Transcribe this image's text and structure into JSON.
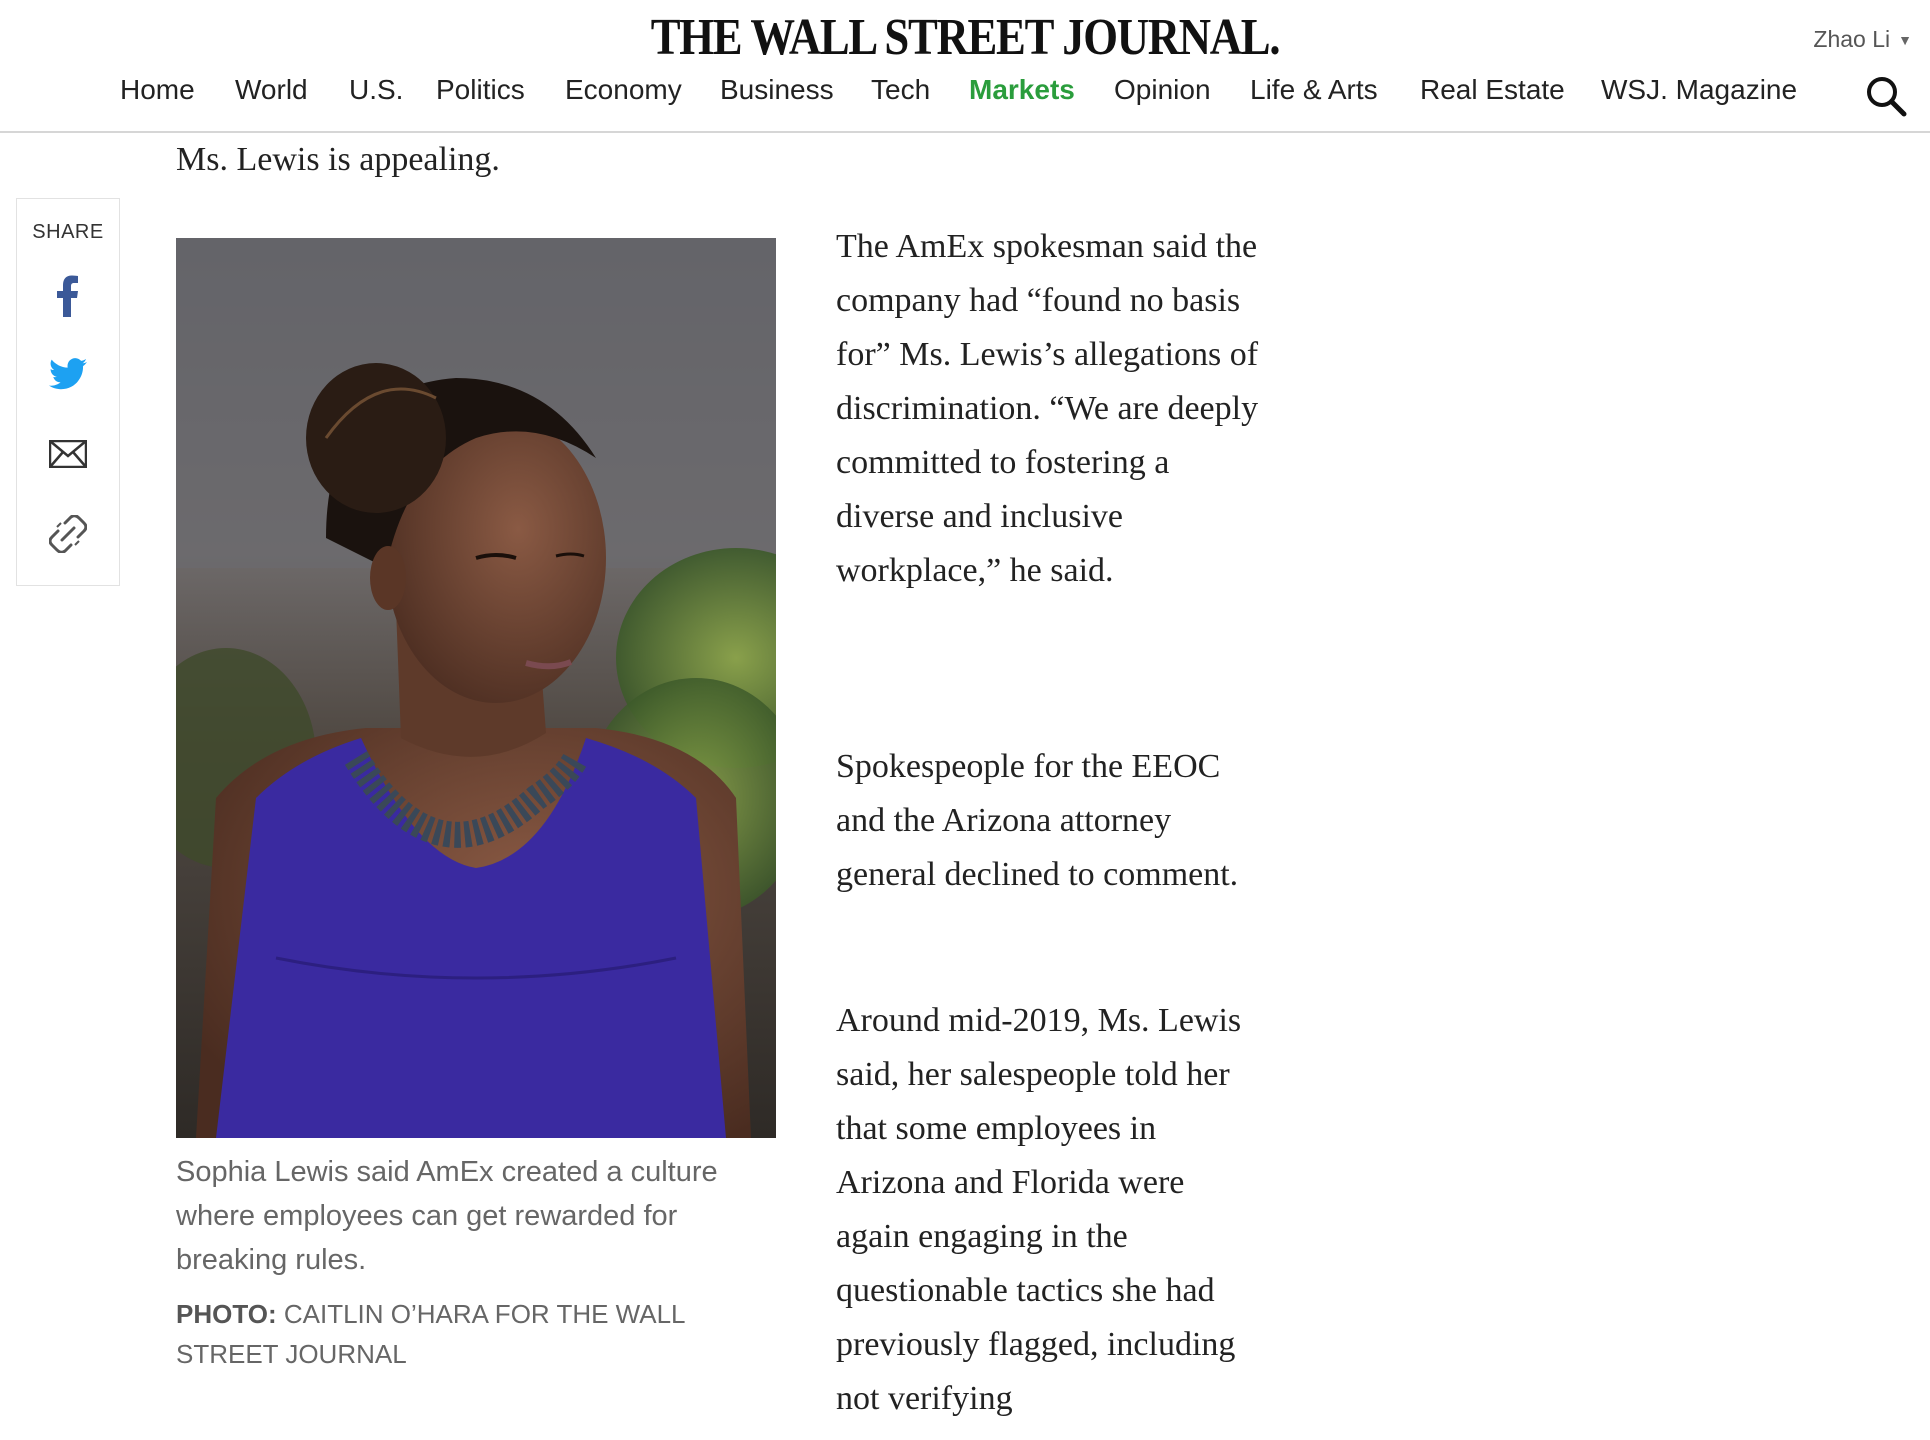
{
  "header": {
    "logo": "THE WALL STREET JOURNAL.",
    "user_name": "Zhao Li",
    "nav": [
      {
        "label": "Home",
        "active": false
      },
      {
        "label": "World",
        "active": false
      },
      {
        "label": "U.S.",
        "active": false
      },
      {
        "label": "Politics",
        "active": false
      },
      {
        "label": "Economy",
        "active": false
      },
      {
        "label": "Business",
        "active": false
      },
      {
        "label": "Tech",
        "active": false
      },
      {
        "label": "Markets",
        "active": true
      },
      {
        "label": "Opinion",
        "active": false
      },
      {
        "label": "Life & Arts",
        "active": false
      },
      {
        "label": "Real Estate",
        "active": false
      },
      {
        "label": "WSJ. Magazine",
        "active": false
      }
    ],
    "search_icon": "search-icon"
  },
  "share": {
    "label": "SHARE",
    "buttons": [
      {
        "name": "facebook-icon",
        "color": "#3b5998"
      },
      {
        "name": "twitter-icon",
        "color": "#1da1f2"
      },
      {
        "name": "email-icon",
        "color": "#333333"
      },
      {
        "name": "link-icon",
        "color": "#555555"
      }
    ]
  },
  "article": {
    "lead_line": "Ms. Lewis is appealing.",
    "photo": {
      "caption": "Sophia Lewis said AmEx created a culture where employees can get rewarded for breaking rules.",
      "credit_label": "PHOTO:",
      "credit_text": "CAITLIN O’HARA FOR THE WALL STREET JOURNAL"
    },
    "paragraphs": [
      "The AmEx spokesman said the company had “found no basis for” Ms. Lewis’s allegations of discrimination. “We are deeply committed to fostering a diverse and inclusive workplace,” he said.",
      "Spokespeople for the EEOC and the Arizona attorney general declined to comment.",
      "Around mid-2019, Ms. Lewis said, her salespeople told her that some employees in Arizona and Florida were again engaging in the questionable tactics she had previously flagged, including not verifying"
    ]
  },
  "colors": {
    "accent_active_nav": "#2a9d3c",
    "divider": "#d6d6d6",
    "dress": "#3a2aa0"
  }
}
